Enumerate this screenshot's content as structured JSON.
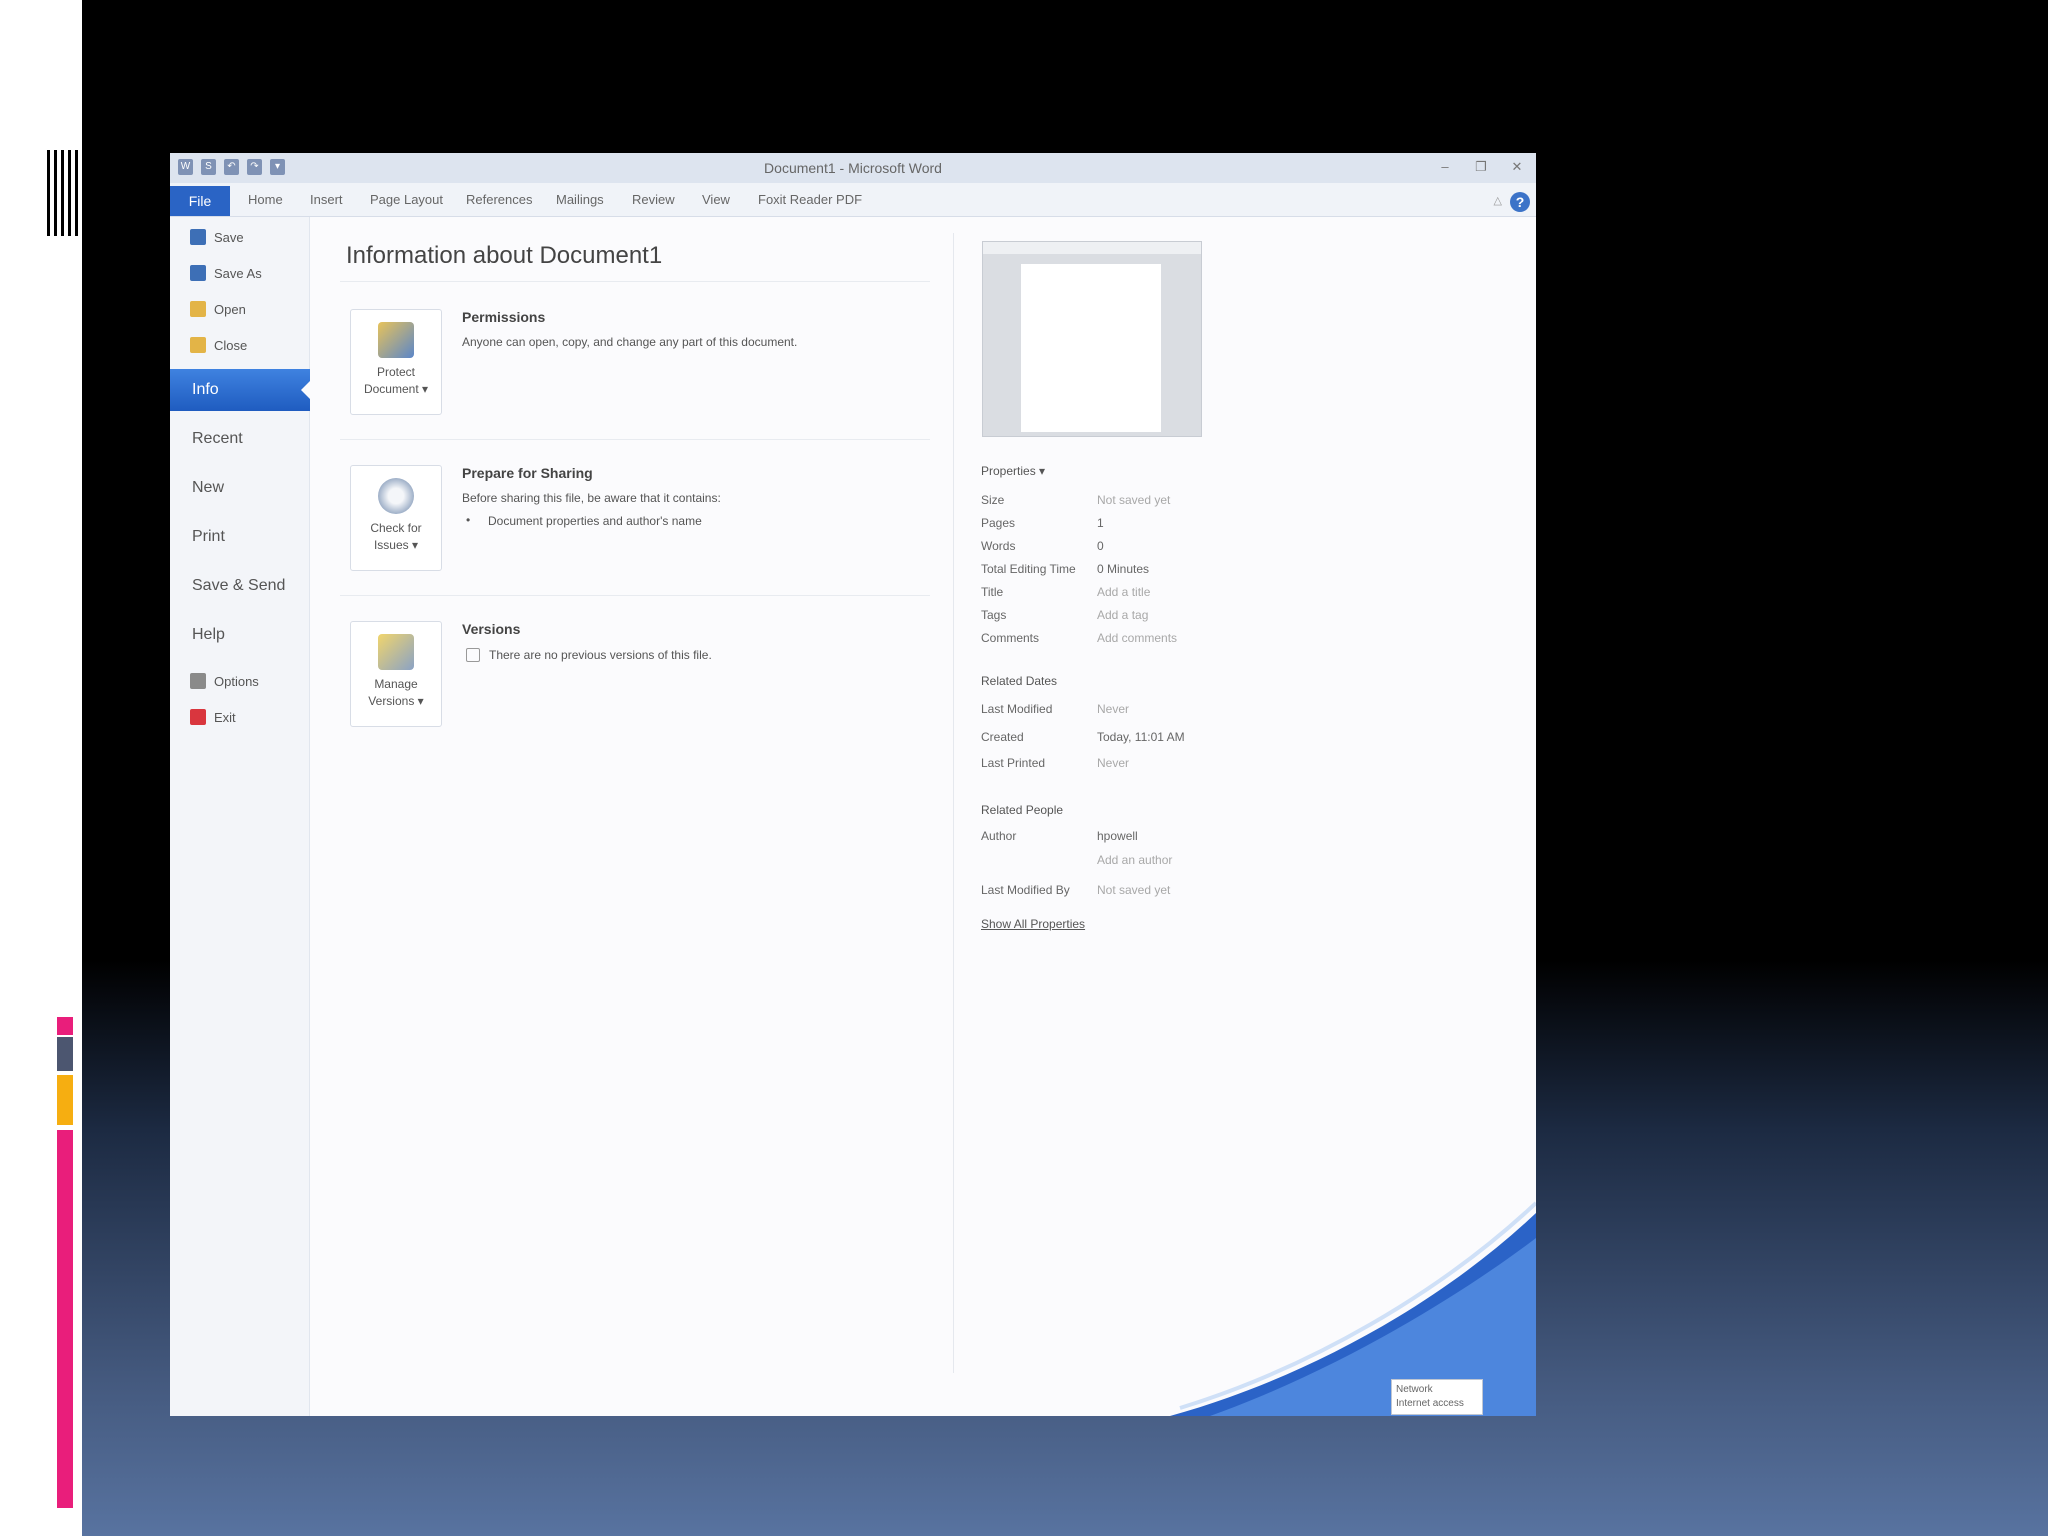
{
  "window": {
    "title": "Document1 - Microsoft Word"
  },
  "quick_access": [
    "W",
    "S",
    "↶",
    "↷",
    "▾"
  ],
  "window_controls": [
    "–",
    "❐",
    "✕"
  ],
  "ribbon": {
    "file_tab": "File",
    "tabs": [
      "Home",
      "Insert",
      "Page Layout",
      "References",
      "Mailings",
      "Review",
      "View",
      "Foxit Reader PDF"
    ],
    "help": "?",
    "minimize": "△"
  },
  "backstage": {
    "commands_top": [
      {
        "label": "Save",
        "icon": "save-icon",
        "color": "#3d6fb6"
      },
      {
        "label": "Save As",
        "icon": "save-as-icon",
        "color": "#3d6fb6"
      },
      {
        "label": "Open",
        "icon": "open-folder-icon",
        "color": "#e3b447"
      },
      {
        "label": "Close",
        "icon": "close-folder-icon",
        "color": "#e3b447"
      }
    ],
    "tabs": [
      "Info",
      "Recent",
      "New",
      "Print",
      "Save & Send",
      "Help"
    ],
    "commands_bottom": [
      {
        "label": "Options",
        "icon": "options-icon",
        "color": "#8a8a8a"
      },
      {
        "label": "Exit",
        "icon": "exit-icon",
        "color": "#d9363e"
      }
    ]
  },
  "info": {
    "title": "Information about Document1",
    "permissions": {
      "button_line1": "Protect",
      "button_line2": "Document ▾",
      "heading": "Permissions",
      "text": "Anyone can open, copy, and change any part of this document."
    },
    "prepare": {
      "button_line1": "Check for",
      "button_line2": "Issues ▾",
      "heading": "Prepare for Sharing",
      "text": "Before sharing this file, be aware that it contains:",
      "bullet": "Document properties and author's name"
    },
    "versions": {
      "button_line1": "Manage",
      "button_line2": "Versions ▾",
      "heading": "Versions",
      "text": "There are no previous versions of this file."
    }
  },
  "properties": {
    "heading": "Properties ▾",
    "rows": [
      {
        "label": "Size",
        "value": "Not saved yet",
        "muted": true
      },
      {
        "label": "Pages",
        "value": "1",
        "muted": false
      },
      {
        "label": "Words",
        "value": "0",
        "muted": false
      },
      {
        "label": "Total Editing Time",
        "value": "0 Minutes",
        "muted": false
      },
      {
        "label": "Title",
        "value": "Add a title",
        "muted": true
      },
      {
        "label": "Tags",
        "value": "Add a tag",
        "muted": true
      },
      {
        "label": "Comments",
        "value": "Add comments",
        "muted": true
      }
    ],
    "related_dates_heading": "Related Dates",
    "dates": [
      {
        "label": "Last Modified",
        "value": "Never",
        "muted": true
      },
      {
        "label": "Created",
        "value": "Today, 11:01 AM",
        "muted": false
      },
      {
        "label": "Last Printed",
        "value": "Never",
        "muted": true
      }
    ],
    "related_people_heading": "Related People",
    "author_label": "Author",
    "author_value": "hpowell",
    "add_author": "Add an author",
    "last_modified_by_label": "Last Modified By",
    "last_modified_by_value": "Not saved yet",
    "show_all": "Show All Properties"
  },
  "network_tip": {
    "line1": "Network",
    "line2": "Internet access"
  }
}
